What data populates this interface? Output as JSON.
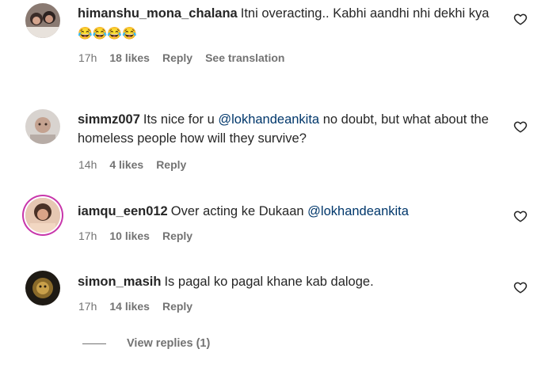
{
  "comments": [
    {
      "username": "himanshu_mona_chalana",
      "text": "Itni overacting.. Kabhi aandhi nhi dekhi kya",
      "emojis": "😂😂😂😂",
      "mention": "",
      "age": "17h",
      "likes": "18 likes",
      "reply": "Reply",
      "translate": "See translation"
    },
    {
      "username": "simmz007",
      "text": "Its nice for u",
      "mention": "@lokhandeankita",
      "text_after": " no doubt, but what about the homeless people how will they survive?",
      "age": "14h",
      "likes": "4 likes",
      "reply": "Reply"
    },
    {
      "username": "iamqu_een012",
      "text": "Over acting ke Dukaan",
      "mention": "@lokhandeankita",
      "age": "17h",
      "likes": "10 likes",
      "reply": "Reply"
    },
    {
      "username": "simon_masih",
      "text": "Is pagal ko pagal khane kab daloge.",
      "age": "17h",
      "likes": "14 likes",
      "reply": "Reply"
    }
  ],
  "view_replies": "View replies (1)",
  "icons": {
    "like": "heart-outline-icon"
  },
  "colors": {
    "mention": "#00376b",
    "meta": "#737373",
    "story_ring": "#c837ab"
  }
}
